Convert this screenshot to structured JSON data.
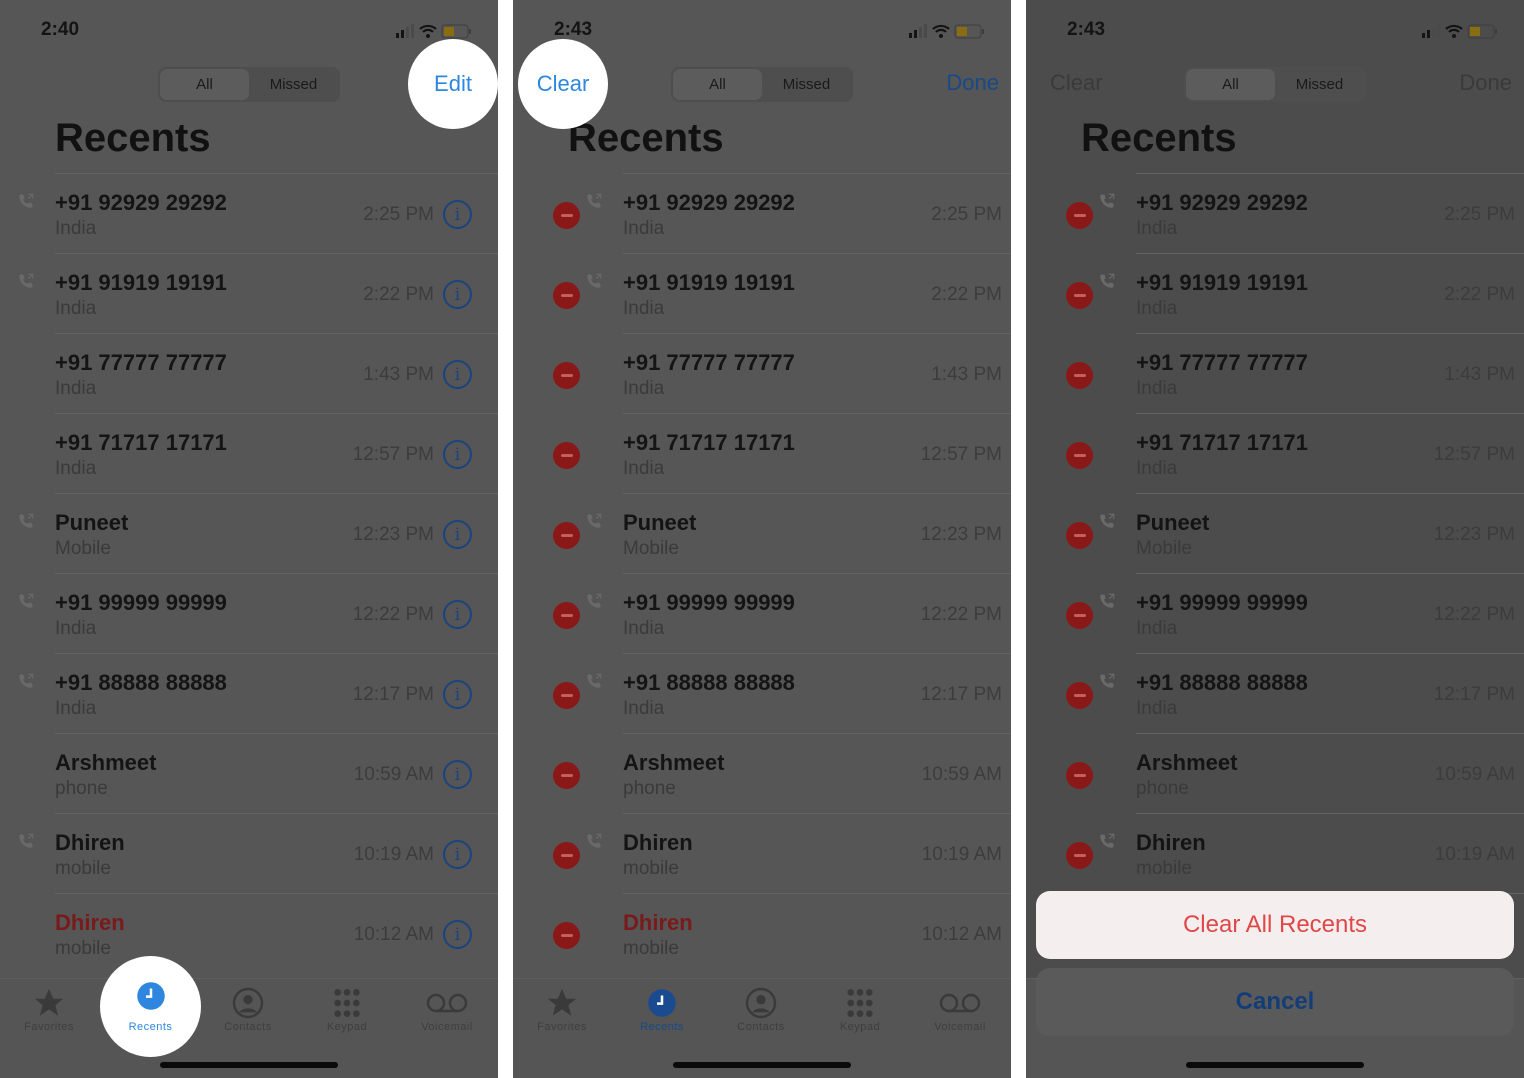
{
  "panels": [
    {
      "time": "2:40",
      "mode": "normal",
      "left_button": "",
      "right_button": "Edit",
      "highlight": [
        "right",
        "recents"
      ]
    },
    {
      "time": "2:43",
      "mode": "edit",
      "left_button": "Clear",
      "right_button": "Done",
      "highlight": [
        "left"
      ]
    },
    {
      "time": "2:43",
      "mode": "sheet",
      "left_button": "Clear",
      "right_button": "Done",
      "highlight": []
    }
  ],
  "segment": {
    "all": "All",
    "missed": "Missed",
    "selected": "All"
  },
  "title": "Recents",
  "calls": [
    {
      "name": "+91 92929 29292",
      "sub": "India",
      "time": "2:25 PM",
      "outgoing": true,
      "missed": false
    },
    {
      "name": "+91 91919 19191",
      "sub": "India",
      "time": "2:22 PM",
      "outgoing": true,
      "missed": false
    },
    {
      "name": "+91 77777 77777",
      "sub": "India",
      "time": "1:43 PM",
      "outgoing": false,
      "missed": false
    },
    {
      "name": "+91 71717 17171",
      "sub": "India",
      "time": "12:57 PM",
      "outgoing": false,
      "missed": false
    },
    {
      "name": "Puneet",
      "sub": "Mobile",
      "time": "12:23 PM",
      "outgoing": true,
      "missed": false
    },
    {
      "name": "+91 99999 99999",
      "sub": "India",
      "time": "12:22 PM",
      "outgoing": true,
      "missed": false
    },
    {
      "name": "+91 88888 88888",
      "sub": "India",
      "time": "12:17 PM",
      "outgoing": true,
      "missed": false
    },
    {
      "name": "Arshmeet",
      "sub": "phone",
      "time": "10:59 AM",
      "outgoing": false,
      "missed": false
    },
    {
      "name": "Dhiren",
      "sub": "mobile",
      "time": "10:19 AM",
      "outgoing": true,
      "missed": false
    },
    {
      "name": "Dhiren",
      "sub": "mobile",
      "time": "10:12 AM",
      "outgoing": false,
      "missed": true
    }
  ],
  "tabs": [
    {
      "label": "Favorites",
      "icon": "star-icon"
    },
    {
      "label": "Recents",
      "icon": "clock-icon",
      "active": true
    },
    {
      "label": "Contacts",
      "icon": "person-circle-icon"
    },
    {
      "label": "Keypad",
      "icon": "keypad-icon"
    },
    {
      "label": "Voicemail",
      "icon": "voicemail-icon"
    }
  ],
  "sheet": {
    "clear_all": "Clear All Recents",
    "cancel": "Cancel"
  },
  "colors": {
    "accent": "#2e86de",
    "destructive": "#e04848",
    "missed": "#7a1a1a",
    "highlight": "#ffffff"
  }
}
